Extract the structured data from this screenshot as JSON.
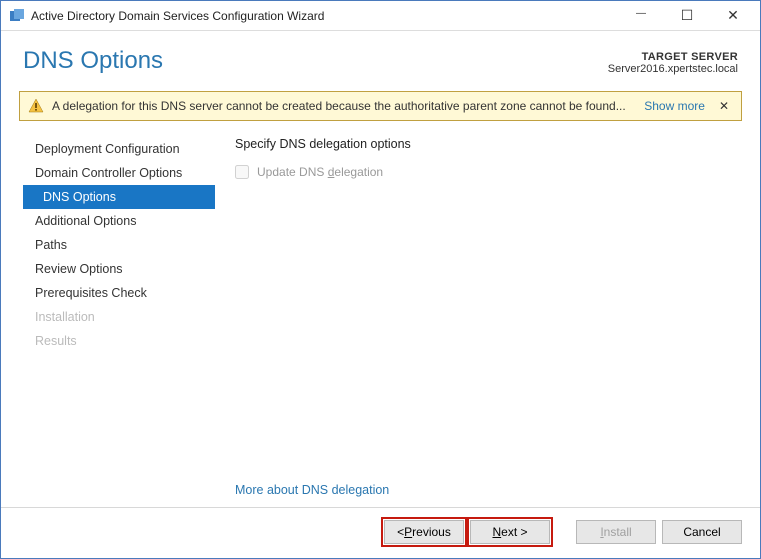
{
  "window": {
    "title": "Active Directory Domain Services Configuration Wizard"
  },
  "header": {
    "heading": "DNS Options",
    "target_label": "TARGET SERVER",
    "target_server": "Server2016.xpertstec.local"
  },
  "warning": {
    "message": "A delegation for this DNS server cannot be created because the authoritative parent zone cannot be found...",
    "show_more": "Show more",
    "close_glyph": "✕"
  },
  "sidebar": {
    "items": [
      {
        "label": "Deployment Configuration"
      },
      {
        "label": "Domain Controller Options"
      },
      {
        "label": "DNS Options"
      },
      {
        "label": "Additional Options"
      },
      {
        "label": "Paths"
      },
      {
        "label": "Review Options"
      },
      {
        "label": "Prerequisites Check"
      },
      {
        "label": "Installation"
      },
      {
        "label": "Results"
      }
    ]
  },
  "content": {
    "desc": "Specify DNS delegation options",
    "checkbox_label_pre": "Update DNS ",
    "checkbox_label_ul": "d",
    "checkbox_label_post": "elegation",
    "more_link": "More about DNS delegation"
  },
  "footer": {
    "prev_pre": "< ",
    "prev_ul": "P",
    "prev_post": "revious",
    "next_ul": "N",
    "next_post": "ext >",
    "install_ul": "I",
    "install_post": "nstall",
    "cancel": "Cancel"
  }
}
